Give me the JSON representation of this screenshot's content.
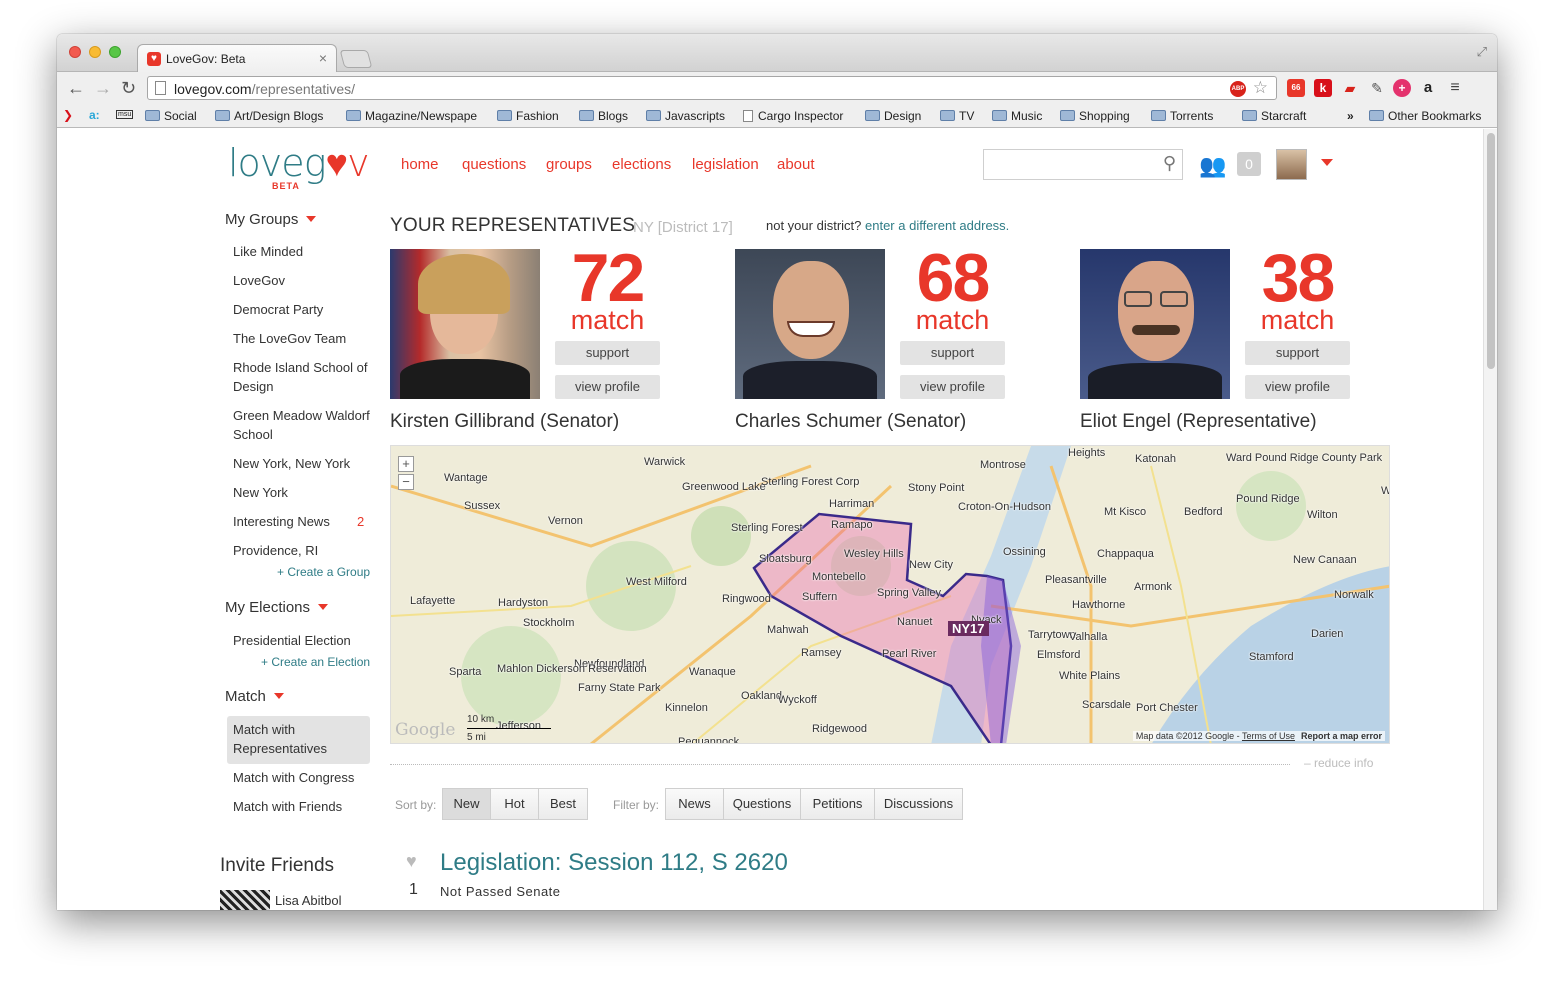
{
  "browser": {
    "tab_title": "LoveGov: Beta",
    "url_domain": "lovegov.com",
    "url_path": "/representatives/",
    "abp_label": "ABP",
    "ext_badge": "66",
    "ext_k": "k",
    "bookmarks": [
      {
        "label": "Social",
        "type": "folder"
      },
      {
        "label": "Art/Design Blogs",
        "type": "folder"
      },
      {
        "label": "Magazine/Newspape",
        "type": "folder"
      },
      {
        "label": "Fashion",
        "type": "folder"
      },
      {
        "label": "Blogs",
        "type": "folder"
      },
      {
        "label": "Javascripts",
        "type": "folder"
      },
      {
        "label": "Cargo Inspector",
        "type": "page"
      },
      {
        "label": "Design",
        "type": "folder"
      },
      {
        "label": "TV",
        "type": "folder"
      },
      {
        "label": "Music",
        "type": "folder"
      },
      {
        "label": "Shopping",
        "type": "folder"
      },
      {
        "label": "Torrents",
        "type": "folder"
      },
      {
        "label": "Starcraft",
        "type": "folder"
      }
    ],
    "bookmarks_overflow": "»",
    "other_bookmarks": "Other Bookmarks"
  },
  "header": {
    "logo_text_1": "love",
    "logo_text_heart": "g",
    "logo_text_2": "♥v",
    "logo_beta": "BETA",
    "nav": [
      "home",
      "questions",
      "groups",
      "elections",
      "legislation",
      "about"
    ],
    "notif_count": "0"
  },
  "sidebar": {
    "groups_heading": "My Groups",
    "groups": [
      {
        "label": "Like Minded",
        "count": ""
      },
      {
        "label": "LoveGov",
        "count": ""
      },
      {
        "label": "Democrat Party",
        "count": ""
      },
      {
        "label": "The LoveGov Team",
        "count": ""
      },
      {
        "label": "Rhode Island School of Design",
        "count": ""
      },
      {
        "label": "Green Meadow Waldorf School",
        "count": ""
      },
      {
        "label": "New York, New York",
        "count": ""
      },
      {
        "label": "New York",
        "count": ""
      },
      {
        "label": "Interesting News",
        "count": "2"
      },
      {
        "label": "Providence, RI",
        "count": ""
      }
    ],
    "create_group": "+ Create a Group",
    "elections_heading": "My Elections",
    "elections": [
      "Presidential Election"
    ],
    "create_election": "+ Create an Election",
    "match_heading": "Match",
    "match_items": [
      "Match with Representatives",
      "Match with Congress",
      "Match with Friends"
    ],
    "invite_heading": "Invite Friends",
    "friend_name": "Lisa Abitbol"
  },
  "reps": {
    "title": "YOUR REPRESENTATIVES",
    "district": "NY [District 17]",
    "not_district": "not your district?",
    "different_address": "enter a different address.",
    "support_label": "support",
    "profile_label": "view profile",
    "match_label": "match",
    "items": [
      {
        "name": "Kirsten Gillibrand (Senator)",
        "score": 72
      },
      {
        "name": "Charles Schumer (Senator)",
        "score": 68
      },
      {
        "name": "Eliot Engel (Representative)",
        "score": 38
      }
    ]
  },
  "map": {
    "district_badge": "NY17",
    "labels": [
      "Warwick",
      "Wantage",
      "Greenwood Lake",
      "Sterling Forest Corp",
      "Harriman",
      "Stony Point",
      "Montrose",
      "Heights",
      "Katonah",
      "Ward Pound Ridge County Park",
      "Croton-On-Hudson",
      "Pound Ridge",
      "West",
      "Sussex",
      "Vernon",
      "Sterling Forest",
      "Ramapo",
      "Mt Kisco",
      "Bedford",
      "Wilton",
      "Sloatsburg",
      "Wesley Hills",
      "New City",
      "Ossining",
      "Chappaqua",
      "New Canaan",
      "West Milford",
      "Montebello",
      "Pleasantville",
      "Armonk",
      "Lafayette",
      "Hardyston",
      "Ringwood",
      "Suffern",
      "Spring Valley",
      "Hawthorne",
      "Norwalk",
      "Stockholm",
      "Nanuet",
      "Nyack",
      "Tarrytown",
      "Valhalla",
      "Darien",
      "Mahwah",
      "Ramsey",
      "Pearl River",
      "Elmsford",
      "Stamford",
      "Sparta",
      "Newfoundland",
      "Wanaque",
      "White Plains",
      "Mahlon Dickerson Reservation",
      "Farny State Park",
      "Oakland",
      "Wyckoff",
      "Scarsdale",
      "Port Chester",
      "Kinnelon",
      "Jefferson",
      "Ridgewood",
      "Pequannock"
    ],
    "scale_km": "10 km",
    "scale_mi": "5 mi",
    "google": "Google",
    "attribution": "Map data ©2012 Google",
    "terms": "Terms of Use",
    "report": "Report a map error",
    "reduce_info": "– reduce info"
  },
  "feed": {
    "sort_label": "Sort by:",
    "sort_options": [
      "New",
      "Hot",
      "Best"
    ],
    "filter_label": "Filter by:",
    "filter_options": [
      "News",
      "Questions",
      "Petitions",
      "Discussions"
    ],
    "item_count": "1",
    "item_title": "Legislation: Session 112, S 2620",
    "item_status": "Not Passed Senate"
  }
}
